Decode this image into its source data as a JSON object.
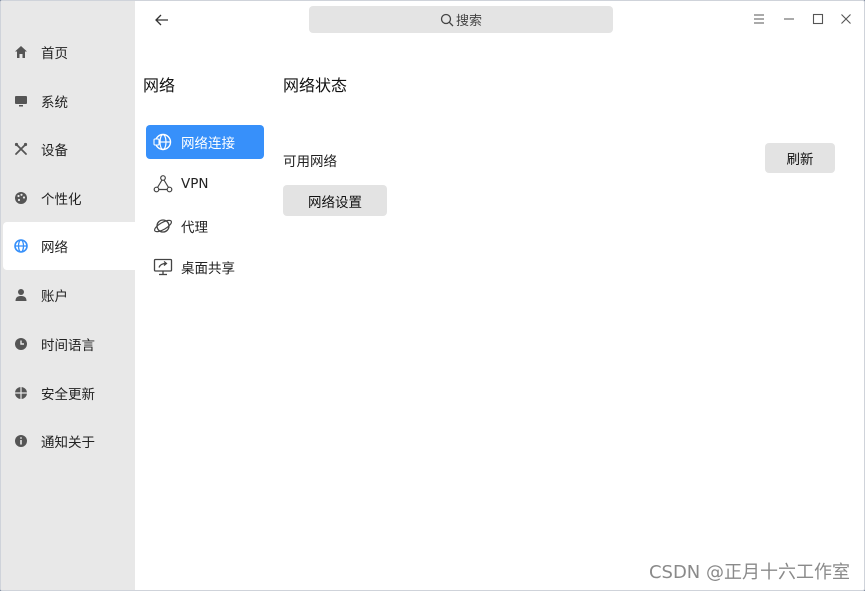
{
  "sidebar": {
    "items": [
      {
        "label": "首页",
        "icon": "home-icon"
      },
      {
        "label": "系统",
        "icon": "monitor-icon"
      },
      {
        "label": "设备",
        "icon": "tools-icon"
      },
      {
        "label": "个性化",
        "icon": "palette-icon"
      },
      {
        "label": "网络",
        "icon": "globe-icon",
        "active": true
      },
      {
        "label": "账户",
        "icon": "user-icon"
      },
      {
        "label": "时间语言",
        "icon": "clock-icon"
      },
      {
        "label": "安全更新",
        "icon": "security-icon"
      },
      {
        "label": "通知关于",
        "icon": "info-icon"
      }
    ]
  },
  "header": {
    "search_placeholder": "搜索"
  },
  "subnav": {
    "title": "网络",
    "items": [
      {
        "label": "网络连接",
        "icon": "network-connection-icon",
        "active": true
      },
      {
        "label": "VPN",
        "icon": "vpn-icon"
      },
      {
        "label": "代理",
        "icon": "proxy-planet-icon"
      },
      {
        "label": "桌面共享",
        "icon": "desktop-share-icon"
      }
    ]
  },
  "main": {
    "title": "网络状态",
    "available_label": "可用网络",
    "refresh_label": "刷新",
    "settings_label": "网络设置"
  },
  "watermark": "CSDN @正月十六工作室",
  "colors": {
    "accent": "#3790fa",
    "sidebar_bg": "#e8e8e8",
    "button_bg": "#e3e3e3"
  }
}
